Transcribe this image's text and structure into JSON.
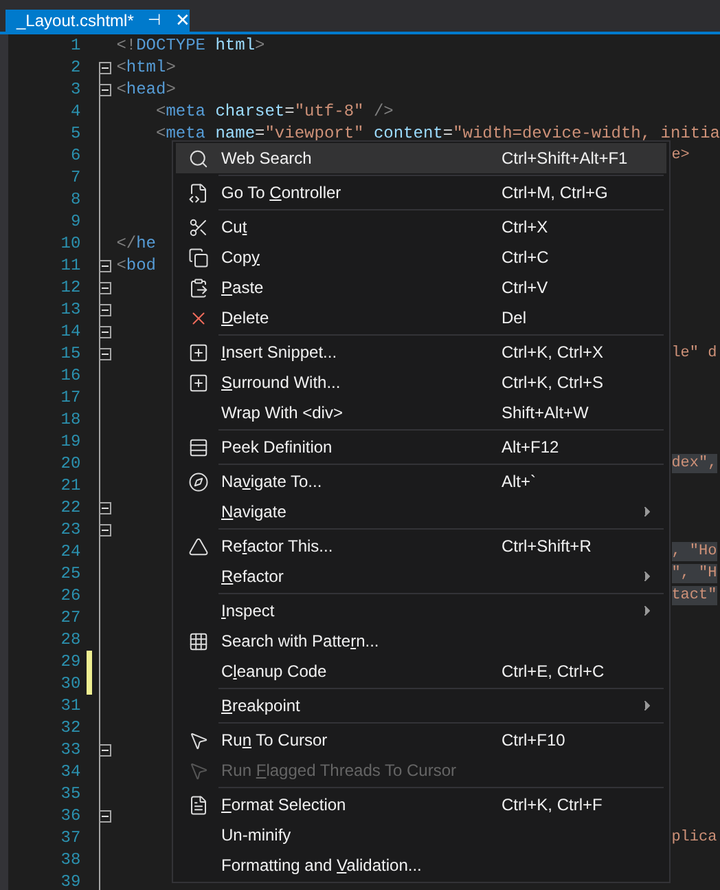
{
  "tab": {
    "title": "_Layout.cshtml*",
    "pin": "⊣",
    "close": "✕",
    "selected": true
  },
  "lines": [
    {
      "number": "1",
      "foldable": false,
      "changed": false,
      "code": [
        {
          "kind": "punct",
          "text": "<!"
        },
        {
          "kind": "tag",
          "text": "DOCTYPE"
        },
        {
          "kind": "attr",
          "text": " html"
        },
        {
          "kind": "punct",
          "text": ">"
        }
      ]
    },
    {
      "number": "2",
      "foldable": true,
      "changed": false,
      "code": [
        {
          "kind": "punct",
          "text": "<"
        },
        {
          "kind": "tag",
          "text": "html"
        },
        {
          "kind": "punct",
          "text": ">"
        }
      ]
    },
    {
      "number": "3",
      "foldable": true,
      "changed": false,
      "code": [
        {
          "kind": "punct",
          "text": "<"
        },
        {
          "kind": "tag",
          "text": "head"
        },
        {
          "kind": "punct",
          "text": ">"
        }
      ]
    },
    {
      "number": "4",
      "foldable": false,
      "changed": false,
      "code": [
        {
          "kind": "punct",
          "text": "    <"
        },
        {
          "kind": "tag",
          "text": "meta"
        },
        {
          "kind": "attr",
          "text": " charset"
        },
        {
          "kind": "plain",
          "text": "="
        },
        {
          "kind": "string",
          "text": "\"utf-8\""
        },
        {
          "kind": "punct",
          "text": " />"
        }
      ]
    },
    {
      "number": "5",
      "foldable": false,
      "changed": false,
      "code": [
        {
          "kind": "punct",
          "text": "    <"
        },
        {
          "kind": "tag",
          "text": "meta"
        },
        {
          "kind": "attr",
          "text": " name"
        },
        {
          "kind": "plain",
          "text": "="
        },
        {
          "kind": "string",
          "text": "\"viewport\""
        },
        {
          "kind": "attr",
          "text": " content"
        },
        {
          "kind": "plain",
          "text": "="
        },
        {
          "kind": "string",
          "text": "\"width=device-width, initia"
        }
      ]
    },
    {
      "number": "6",
      "foldable": false,
      "changed": false,
      "tail": {
        "text": "e>",
        "selected": false
      }
    },
    {
      "number": "7",
      "foldable": false,
      "changed": false
    },
    {
      "number": "8",
      "foldable": false,
      "changed": false
    },
    {
      "number": "9",
      "foldable": false,
      "changed": false
    },
    {
      "number": "10",
      "foldable": false,
      "changed": false,
      "code": [
        {
          "kind": "punct",
          "text": "</"
        },
        {
          "kind": "tag",
          "text": "he"
        }
      ]
    },
    {
      "number": "11",
      "foldable": true,
      "changed": false,
      "code": [
        {
          "kind": "punct",
          "text": "<"
        },
        {
          "kind": "tag",
          "text": "bod"
        }
      ]
    },
    {
      "number": "12",
      "foldable": true,
      "changed": false
    },
    {
      "number": "13",
      "foldable": true,
      "changed": false
    },
    {
      "number": "14",
      "foldable": true,
      "changed": false
    },
    {
      "number": "15",
      "foldable": true,
      "changed": false,
      "tail": {
        "text": "le\" d",
        "selected": false
      }
    },
    {
      "number": "16",
      "foldable": false,
      "changed": false
    },
    {
      "number": "17",
      "foldable": false,
      "changed": false
    },
    {
      "number": "18",
      "foldable": false,
      "changed": false
    },
    {
      "number": "19",
      "foldable": false,
      "changed": false
    },
    {
      "number": "20",
      "foldable": false,
      "changed": false,
      "tail": {
        "text": "dex\",",
        "selected": true
      }
    },
    {
      "number": "21",
      "foldable": false,
      "changed": false
    },
    {
      "number": "22",
      "foldable": true,
      "changed": false
    },
    {
      "number": "23",
      "foldable": true,
      "changed": false
    },
    {
      "number": "24",
      "foldable": false,
      "changed": false,
      "tail": {
        "text": ", \"Ho",
        "selected": true
      }
    },
    {
      "number": "25",
      "foldable": false,
      "changed": false,
      "tail": {
        "text": "\", \"H",
        "selected": true
      }
    },
    {
      "number": "26",
      "foldable": false,
      "changed": false,
      "tail": {
        "text": "tact\"",
        "selected": true
      }
    },
    {
      "number": "27",
      "foldable": false,
      "changed": false
    },
    {
      "number": "28",
      "foldable": false,
      "changed": false
    },
    {
      "number": "29",
      "foldable": false,
      "changed": true
    },
    {
      "number": "30",
      "foldable": false,
      "changed": true
    },
    {
      "number": "31",
      "foldable": false,
      "changed": false
    },
    {
      "number": "32",
      "foldable": false,
      "changed": false
    },
    {
      "number": "33",
      "foldable": true,
      "changed": false
    },
    {
      "number": "34",
      "foldable": false,
      "changed": false
    },
    {
      "number": "35",
      "foldable": false,
      "changed": false
    },
    {
      "number": "36",
      "foldable": true,
      "changed": false
    },
    {
      "number": "37",
      "foldable": false,
      "changed": false,
      "tail": {
        "text": "plica",
        "selected": false
      }
    },
    {
      "number": "38",
      "foldable": false,
      "changed": false
    },
    {
      "number": "39",
      "foldable": false,
      "changed": false
    }
  ],
  "context_menu": [
    {
      "kind": "item",
      "label": [
        {
          "text": "Web Search",
          "underlined": false
        }
      ],
      "shortcut": "Ctrl+Shift+Alt+F1",
      "selected": true,
      "disabled": false
    },
    {
      "kind": "separator"
    },
    {
      "kind": "item",
      "label": [
        {
          "text": "Go To ",
          "underlined": false
        },
        {
          "text": "C",
          "underlined": true
        },
        {
          "text": "ontroller",
          "underlined": false
        }
      ],
      "shortcut": "Ctrl+M, Ctrl+G",
      "selected": false,
      "disabled": false
    },
    {
      "kind": "separator"
    },
    {
      "kind": "item",
      "label": [
        {
          "text": "Cu",
          "underlined": false
        },
        {
          "text": "t",
          "underlined": true
        }
      ],
      "shortcut": "Ctrl+X",
      "selected": false,
      "disabled": false
    },
    {
      "kind": "item",
      "label": [
        {
          "text": "Cop",
          "underlined": false
        },
        {
          "text": "y",
          "underlined": true
        }
      ],
      "shortcut": "Ctrl+C",
      "selected": false,
      "disabled": false
    },
    {
      "kind": "item",
      "label": [
        {
          "text": "P",
          "underlined": true
        },
        {
          "text": "aste",
          "underlined": false
        }
      ],
      "shortcut": "Ctrl+V",
      "selected": false,
      "disabled": false
    },
    {
      "kind": "item",
      "label": [
        {
          "text": "D",
          "underlined": true
        },
        {
          "text": "elete",
          "underlined": false
        }
      ],
      "shortcut": "Del",
      "selected": false,
      "disabled": false
    },
    {
      "kind": "separator"
    },
    {
      "kind": "item",
      "label": [
        {
          "text": "I",
          "underlined": true
        },
        {
          "text": "nsert Snippet...",
          "underlined": false
        }
      ],
      "shortcut": "Ctrl+K, Ctrl+X",
      "selected": false,
      "disabled": false
    },
    {
      "kind": "item",
      "label": [
        {
          "text": "S",
          "underlined": true
        },
        {
          "text": "urround With...",
          "underlined": false
        }
      ],
      "shortcut": "Ctrl+K, Ctrl+S",
      "selected": false,
      "disabled": false
    },
    {
      "kind": "item",
      "label": [
        {
          "text": "Wrap With <div>",
          "underlined": false
        }
      ],
      "shortcut": "Shift+Alt+W",
      "selected": false,
      "disabled": false
    },
    {
      "kind": "separator"
    },
    {
      "kind": "item",
      "label": [
        {
          "text": "Peek Definition",
          "underlined": false
        }
      ],
      "shortcut": "Alt+F12",
      "selected": false,
      "disabled": false
    },
    {
      "kind": "separator"
    },
    {
      "kind": "item",
      "label": [
        {
          "text": "Na",
          "underlined": false
        },
        {
          "text": "v",
          "underlined": true
        },
        {
          "text": "igate To...",
          "underlined": false
        }
      ],
      "shortcut": "Alt+`",
      "selected": false,
      "disabled": false
    },
    {
      "kind": "submenu",
      "label": [
        {
          "text": "N",
          "underlined": true
        },
        {
          "text": "avigate",
          "underlined": false
        }
      ],
      "selected": false,
      "disabled": false
    },
    {
      "kind": "separator"
    },
    {
      "kind": "item",
      "label": [
        {
          "text": "Re",
          "underlined": false
        },
        {
          "text": "f",
          "underlined": true
        },
        {
          "text": "actor This...",
          "underlined": false
        }
      ],
      "shortcut": "Ctrl+Shift+R",
      "selected": false,
      "disabled": false
    },
    {
      "kind": "submenu",
      "label": [
        {
          "text": "R",
          "underlined": true
        },
        {
          "text": "efactor",
          "underlined": false
        }
      ],
      "selected": false,
      "disabled": false
    },
    {
      "kind": "separator"
    },
    {
      "kind": "submenu",
      "label": [
        {
          "text": "I",
          "underlined": true
        },
        {
          "text": "nspect",
          "underlined": false
        }
      ],
      "selected": false,
      "disabled": false
    },
    {
      "kind": "item",
      "label": [
        {
          "text": "Search with Patte",
          "underlined": false
        },
        {
          "text": "r",
          "underlined": true
        },
        {
          "text": "n...",
          "underlined": false
        }
      ],
      "selected": false,
      "disabled": false
    },
    {
      "kind": "item",
      "label": [
        {
          "text": "C",
          "underlined": false
        },
        {
          "text": "l",
          "underlined": true
        },
        {
          "text": "eanup Code",
          "underlined": false
        }
      ],
      "shortcut": "Ctrl+E, Ctrl+C",
      "selected": false,
      "disabled": false
    },
    {
      "kind": "separator"
    },
    {
      "kind": "submenu",
      "label": [
        {
          "text": "B",
          "underlined": true
        },
        {
          "text": "reakpoint",
          "underlined": false
        }
      ],
      "selected": false,
      "disabled": false
    },
    {
      "kind": "separator"
    },
    {
      "kind": "item",
      "label": [
        {
          "text": "Ru",
          "underlined": false
        },
        {
          "text": "n",
          "underlined": true
        },
        {
          "text": " To Cursor",
          "underlined": false
        }
      ],
      "shortcut": "Ctrl+F10",
      "selected": false,
      "disabled": false
    },
    {
      "kind": "item",
      "label": [
        {
          "text": "Run ",
          "underlined": false
        },
        {
          "text": "F",
          "underlined": true
        },
        {
          "text": "lagged Threads To Cursor",
          "underlined": false
        }
      ],
      "selected": false,
      "disabled": true
    },
    {
      "kind": "separator"
    },
    {
      "kind": "item",
      "label": [
        {
          "text": "F",
          "underlined": true
        },
        {
          "text": "ormat Selection",
          "underlined": false
        }
      ],
      "shortcut": "Ctrl+K, Ctrl+F",
      "selected": false,
      "disabled": false
    },
    {
      "kind": "item",
      "label": [
        {
          "text": "Un-minify",
          "underlined": false
        }
      ],
      "selected": false,
      "disabled": false
    },
    {
      "kind": "item",
      "label": [
        {
          "text": "Formatting and ",
          "underlined": false
        },
        {
          "text": "V",
          "underlined": true
        },
        {
          "text": "alidation...",
          "underlined": false
        }
      ],
      "selected": false,
      "disabled": false
    }
  ]
}
